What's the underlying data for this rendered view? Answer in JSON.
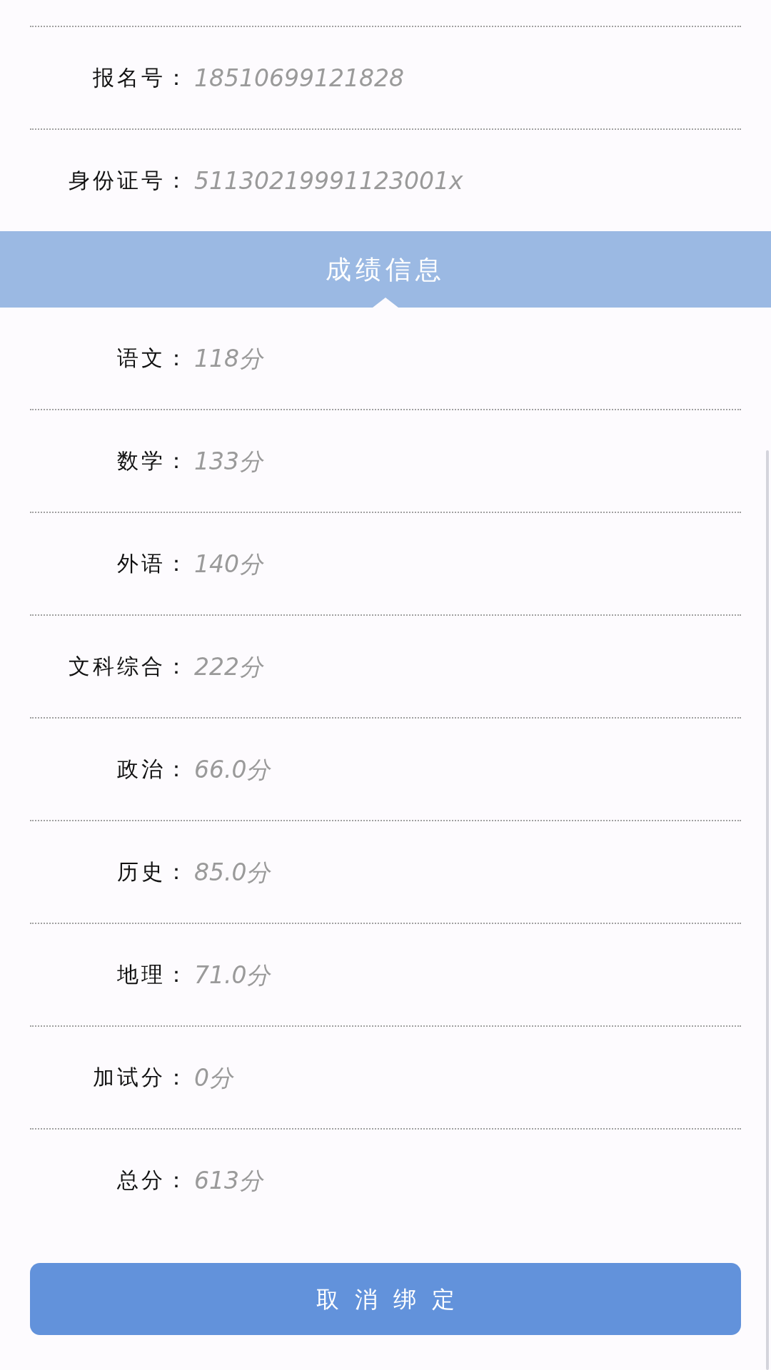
{
  "info_rows": [
    {
      "label": "报名号：",
      "value": "18510699121828"
    },
    {
      "label": "身份证号：",
      "value": "51130219991123001x"
    }
  ],
  "scores_section": {
    "title": "成绩信息",
    "rows": [
      {
        "label": "语文：",
        "value": "118分"
      },
      {
        "label": "数学：",
        "value": "133分"
      },
      {
        "label": "外语：",
        "value": "140分"
      },
      {
        "label": "文科综合：",
        "value": "222分"
      },
      {
        "label": "政治：",
        "value": "66.0分"
      },
      {
        "label": "历史：",
        "value": "85.0分"
      },
      {
        "label": "地理：",
        "value": "71.0分"
      },
      {
        "label": "加试分：",
        "value": "0分"
      },
      {
        "label": "总分：",
        "value": "613分"
      }
    ]
  },
  "unbind_button": {
    "label": "取消绑定"
  }
}
